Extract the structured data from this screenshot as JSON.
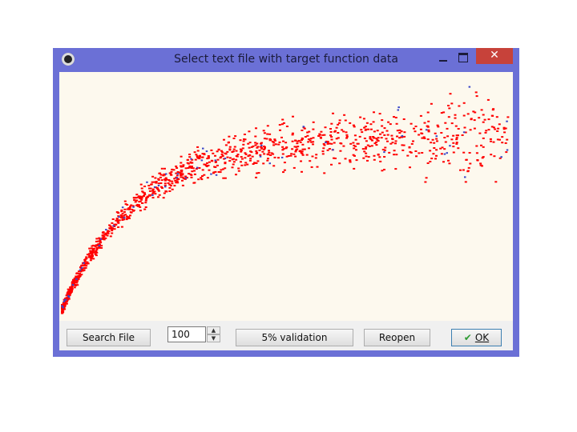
{
  "window": {
    "title": "Select text file with target function data",
    "close_glyph": "✕"
  },
  "icons": {
    "app": "app-icon",
    "minimize": "minimize-icon",
    "maximize": "maximize-icon",
    "close": "close-icon",
    "check": "check-icon",
    "spin_up": "chevron-up-icon",
    "spin_down": "chevron-down-icon"
  },
  "footer": {
    "search_label": "Search File",
    "count_value": "100",
    "validation_label": "5% validation",
    "reopen_label": "Reopen",
    "ok_check": "✔",
    "ok_label": "OK"
  },
  "colors": {
    "title_bar": "#6b70d6",
    "plot_background": "#fdf9ee",
    "points_primary": "#ff0000",
    "points_secondary": "#3a46c8",
    "close_button": "#c7423a"
  },
  "chart_data": {
    "type": "scatter",
    "title": "",
    "xlabel": "",
    "ylabel": "",
    "axes_visible": false,
    "grid": false,
    "series": [
      {
        "color": "#ff0000",
        "points_approx": 1200
      },
      {
        "color": "#3a46c8",
        "points_approx": 60
      }
    ],
    "trend": "rapid concave rise from bottom-left, flattening toward top-right with widening scatter"
  }
}
